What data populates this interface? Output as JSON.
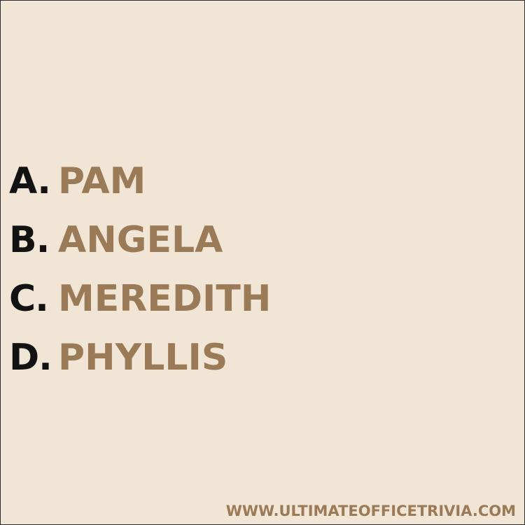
{
  "options": [
    {
      "letter": "A.",
      "answer": "PAM"
    },
    {
      "letter": "B.",
      "answer": "ANGELA"
    },
    {
      "letter": "C.",
      "answer": "MEREDITH"
    },
    {
      "letter": "D.",
      "answer": "PHYLLIS"
    }
  ],
  "footer": {
    "website": "WWW.ULTIMATEOFFICETRIVIA.COM"
  },
  "colors": {
    "background": "#f1e5d6",
    "letter": "#121212",
    "accent": "#9b7b57"
  }
}
